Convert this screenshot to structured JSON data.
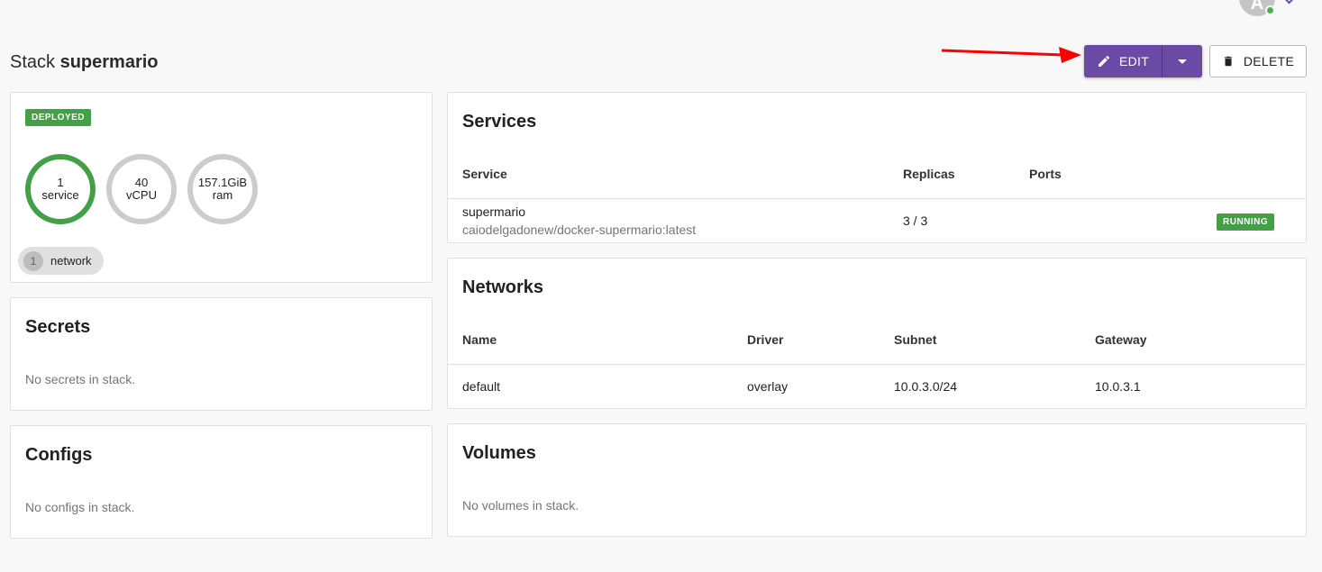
{
  "user": {
    "avatar_initial": "A"
  },
  "page": {
    "title_prefix": "Stack",
    "stack_name": "supermario"
  },
  "toolbar": {
    "edit_label": "EDIT",
    "delete_label": "DELETE",
    "accent": "#6a4aa5"
  },
  "summary": {
    "status": "DEPLOYED",
    "gauges": [
      {
        "value": "1",
        "unit": "service",
        "color": "#43a047"
      },
      {
        "value": "40",
        "unit": "vCPU",
        "color": "#cccccc"
      },
      {
        "value": "157.1GiB",
        "unit": "ram",
        "color": "#cccccc"
      }
    ],
    "network_count": "1",
    "network_label": "network"
  },
  "secrets": {
    "title": "Secrets",
    "empty": "No secrets in stack."
  },
  "configs": {
    "title": "Configs",
    "empty": "No configs in stack."
  },
  "services": {
    "title": "Services",
    "columns": [
      "Service",
      "Replicas",
      "Ports"
    ],
    "rows": [
      {
        "name": "supermario",
        "image": "caiodelgadonew/docker-supermario:latest",
        "replicas": "3 / 3",
        "ports": "",
        "status": "RUNNING"
      }
    ]
  },
  "networks": {
    "title": "Networks",
    "columns": [
      "Name",
      "Driver",
      "Subnet",
      "Gateway"
    ],
    "rows": [
      {
        "name": "default",
        "driver": "overlay",
        "subnet": "10.0.3.0/24",
        "gateway": "10.0.3.1"
      }
    ]
  },
  "volumes": {
    "title": "Volumes",
    "empty": "No volumes in stack."
  }
}
